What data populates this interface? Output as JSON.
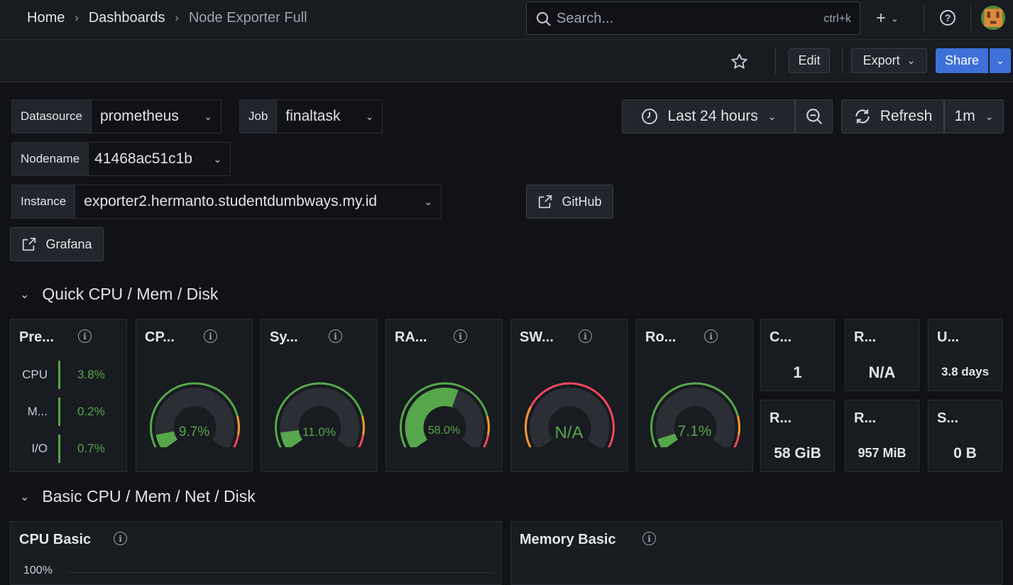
{
  "breadcrumb": {
    "home": "Home",
    "dashboards": "Dashboards",
    "current": "Node Exporter Full"
  },
  "search": {
    "placeholder": "Search...",
    "shortcut": "ctrl+k"
  },
  "toolbar": {
    "edit": "Edit",
    "export": "Export",
    "share": "Share"
  },
  "variables": {
    "datasource": {
      "label": "Datasource",
      "value": "prometheus"
    },
    "job": {
      "label": "Job",
      "value": "finaltask"
    },
    "nodename": {
      "label": "Nodename",
      "value": "41468ac51c1b"
    },
    "instance": {
      "label": "Instance",
      "value": "exporter2.hermanto.studentdumbways.my.id"
    }
  },
  "links": {
    "github": "GitHub",
    "grafana": "Grafana"
  },
  "time": {
    "range": "Last 24 hours",
    "refresh": "Refresh",
    "interval": "1m"
  },
  "rows": {
    "quick": "Quick CPU / Mem / Disk",
    "basic": "Basic CPU / Mem / Net / Disk"
  },
  "pressure": {
    "title": "Pre...",
    "items": [
      {
        "label": "CPU",
        "value": "3.8%"
      },
      {
        "label": "M...",
        "value": "0.2%"
      },
      {
        "label": "I/O",
        "value": "0.7%"
      }
    ]
  },
  "gauges": [
    {
      "title": "CP...",
      "value": "9.7%",
      "level": 9.7
    },
    {
      "title": "Sy...",
      "value": "11.0%",
      "level": 11.0
    },
    {
      "title": "RA...",
      "value": "58.0%",
      "level": 58.0
    },
    {
      "title": "SW...",
      "value": "N/A",
      "level": null
    },
    {
      "title": "Ro...",
      "value": "7.1%",
      "level": 7.1
    }
  ],
  "stats": [
    {
      "title": "C...",
      "value": "1"
    },
    {
      "title": "R...",
      "value": "N/A"
    },
    {
      "title": "U...",
      "value": "3.8 days"
    },
    {
      "title": "R...",
      "value": "58 GiB"
    },
    {
      "title": "R...",
      "value": "957 MiB"
    },
    {
      "title": "S...",
      "value": "0 B"
    }
  ],
  "basic_panels": {
    "cpu": "CPU Basic",
    "memory": "Memory Basic",
    "cpu_axis_top": "100%"
  },
  "colors": {
    "green": "#56a64b",
    "orange": "#ff9830",
    "red": "#f2495c",
    "accent": "#3d71d9"
  }
}
